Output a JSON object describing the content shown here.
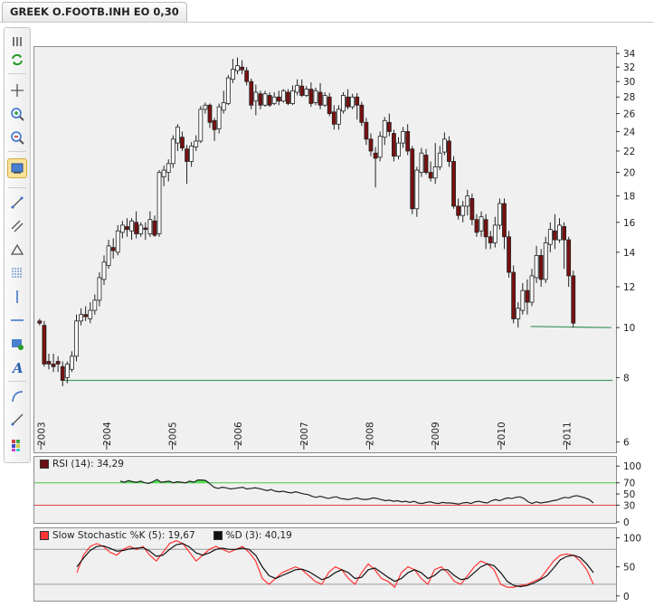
{
  "tab": {
    "label": "GREEK O.FOOTB.INH EO 0,30"
  },
  "toolbar": {
    "icons": [
      "grip-icon",
      "refresh-icon",
      "crosshair-icon",
      "zoom-in-icon",
      "zoom-out-icon",
      "chart-settings-icon",
      "trendline-icon",
      "channel-icon",
      "triangle-tool-icon",
      "fibonacci-icon",
      "vertical-line-icon",
      "horizontal-line-icon",
      "rectangle-tool-icon",
      "text-tool-icon",
      "arc-tool-icon",
      "ray-tool-icon",
      "palette-icon"
    ],
    "active": "chart-settings-icon"
  },
  "chart_data": [
    {
      "type": "candlestick",
      "y_scale": "log",
      "ylim": [
        5.8,
        35
      ],
      "y_ticks": [
        6,
        8,
        10,
        12,
        14,
        16,
        18,
        20,
        22,
        24,
        26,
        28,
        30,
        32,
        34
      ],
      "x_ticks": [
        "2003",
        "2004",
        "2005",
        "2006",
        "2007",
        "2008",
        "2009",
        "2010",
        "2011"
      ],
      "x_range": [
        2002.9,
        2011.75
      ],
      "colors": {
        "up": "#ffffff",
        "down": "#7a1010",
        "outline": "#222222",
        "trendline": "#4a9a6a"
      },
      "grid": false,
      "trendlines": [
        {
          "from": [
            2003.35,
            7.9
          ],
          "to": [
            2011.7,
            7.9
          ]
        },
        {
          "from": [
            2010.45,
            10.05
          ],
          "to": [
            2011.68,
            10.0
          ]
        }
      ],
      "candles": [
        [
          2002.98,
          10.3,
          10.2,
          10.4,
          10.1
        ],
        [
          2003.05,
          10.1,
          8.5,
          10.3,
          8.4
        ],
        [
          2003.12,
          8.6,
          8.5,
          8.9,
          8.3
        ],
        [
          2003.19,
          8.5,
          8.4,
          8.9,
          8.2
        ],
        [
          2003.26,
          8.6,
          8.5,
          8.8,
          8.2
        ],
        [
          2003.33,
          8.4,
          7.9,
          8.6,
          7.7
        ],
        [
          2003.4,
          8.0,
          8.5,
          8.6,
          7.8
        ],
        [
          2003.47,
          8.3,
          8.8,
          9.0,
          8.2
        ],
        [
          2003.54,
          8.8,
          10.3,
          10.6,
          8.6
        ],
        [
          2003.61,
          10.3,
          10.6,
          10.9,
          10.1
        ],
        [
          2003.68,
          10.6,
          10.5,
          11.0,
          10.3
        ],
        [
          2003.75,
          10.4,
          10.8,
          11.2,
          10.2
        ],
        [
          2003.82,
          10.8,
          11.3,
          11.6,
          10.6
        ],
        [
          2003.89,
          11.3,
          12.5,
          12.8,
          11.0
        ],
        [
          2003.96,
          12.4,
          13.4,
          13.8,
          12.1
        ],
        [
          2004.03,
          13.2,
          14.4,
          14.8,
          13.0
        ],
        [
          2004.1,
          14.3,
          14.1,
          14.9,
          13.6
        ],
        [
          2004.17,
          14.0,
          15.4,
          15.8,
          13.8
        ],
        [
          2004.24,
          15.3,
          15.8,
          16.1,
          14.9
        ],
        [
          2004.31,
          15.7,
          15.5,
          16.3,
          15.0
        ],
        [
          2004.38,
          15.4,
          16.1,
          16.3,
          14.8
        ],
        [
          2004.45,
          16.0,
          15.2,
          16.8,
          14.9
        ],
        [
          2004.52,
          15.2,
          15.8,
          16.0,
          15.0
        ],
        [
          2004.59,
          15.6,
          15.5,
          16.0,
          14.8
        ],
        [
          2004.66,
          15.2,
          16.2,
          16.8,
          15.0
        ],
        [
          2004.73,
          16.1,
          15.1,
          16.5,
          15.0
        ],
        [
          2004.8,
          15.2,
          20.0,
          20.2,
          15.0
        ],
        [
          2004.87,
          19.6,
          20.2,
          20.6,
          18.8
        ],
        [
          2004.94,
          20.0,
          20.8,
          21.2,
          19.2
        ],
        [
          2005.01,
          20.8,
          23.2,
          23.6,
          20.4
        ],
        [
          2005.08,
          22.8,
          24.5,
          24.8,
          22.0
        ],
        [
          2005.15,
          23.4,
          22.3,
          24.0,
          22.0
        ],
        [
          2005.22,
          22.2,
          21.0,
          22.6,
          19.0
        ],
        [
          2005.29,
          21.0,
          22.5,
          22.9,
          20.5
        ],
        [
          2005.36,
          22.4,
          23.0,
          23.6,
          22.0
        ],
        [
          2005.43,
          23.0,
          26.5,
          26.9,
          22.8
        ],
        [
          2005.5,
          26.5,
          27.0,
          27.3,
          26.0
        ],
        [
          2005.57,
          27.0,
          25.0,
          27.2,
          24.4
        ],
        [
          2005.64,
          25.2,
          24.2,
          25.5,
          23.0
        ],
        [
          2005.71,
          24.3,
          26.8,
          27.2,
          23.8
        ],
        [
          2005.78,
          26.4,
          27.3,
          28.8,
          26.0
        ],
        [
          2005.85,
          27.2,
          30.5,
          30.9,
          27.0
        ],
        [
          2005.92,
          30.3,
          31.7,
          33.2,
          29.8
        ],
        [
          2005.99,
          31.5,
          32.2,
          33.4,
          31.0
        ],
        [
          2006.06,
          32.0,
          31.6,
          33.0,
          31.0
        ],
        [
          2006.13,
          31.5,
          30.0,
          32.0,
          29.5
        ],
        [
          2006.2,
          30.0,
          27.0,
          30.4,
          26.5
        ],
        [
          2006.27,
          27.5,
          28.6,
          29.6,
          25.8
        ],
        [
          2006.34,
          28.4,
          27.0,
          28.8,
          26.5
        ],
        [
          2006.41,
          27.0,
          28.4,
          28.8,
          26.8
        ],
        [
          2006.48,
          28.2,
          27.0,
          28.6,
          26.8
        ],
        [
          2006.55,
          27.2,
          28.0,
          28.6,
          27.0
        ],
        [
          2006.62,
          28.0,
          27.5,
          28.8,
          27.0
        ],
        [
          2006.69,
          27.5,
          28.8,
          29.0,
          27.3
        ],
        [
          2006.76,
          28.6,
          27.2,
          29.0,
          27.0
        ],
        [
          2006.83,
          27.2,
          28.8,
          29.5,
          27.0
        ],
        [
          2006.9,
          28.6,
          29.5,
          30.3,
          28.2
        ],
        [
          2006.97,
          29.4,
          28.2,
          30.3,
          28.0
        ],
        [
          2007.04,
          28.2,
          29.0,
          29.4,
          28.0
        ],
        [
          2007.11,
          29.0,
          27.2,
          29.9,
          26.8
        ],
        [
          2007.18,
          27.3,
          28.8,
          29.2,
          27.0
        ],
        [
          2007.25,
          28.6,
          27.0,
          29.8,
          26.5
        ],
        [
          2007.32,
          27.0,
          28.2,
          28.6,
          26.8
        ],
        [
          2007.39,
          28.0,
          26.0,
          28.5,
          25.7
        ],
        [
          2007.46,
          26.2,
          24.8,
          27.0,
          24.2
        ],
        [
          2007.53,
          24.8,
          26.5,
          27.0,
          24.2
        ],
        [
          2007.6,
          26.3,
          28.2,
          28.6,
          26.0
        ],
        [
          2007.67,
          28.0,
          26.8,
          29.0,
          26.5
        ],
        [
          2007.74,
          26.8,
          28.0,
          28.4,
          26.5
        ],
        [
          2007.81,
          28.0,
          27.0,
          28.5,
          25.3
        ],
        [
          2007.88,
          27.0,
          25.0,
          27.4,
          24.6
        ],
        [
          2007.95,
          25.0,
          23.2,
          25.5,
          22.6
        ],
        [
          2008.02,
          23.2,
          22.0,
          23.8,
          21.5
        ],
        [
          2008.09,
          21.8,
          21.3,
          22.4,
          18.7
        ],
        [
          2008.16,
          21.4,
          23.5,
          24.0,
          21.0
        ],
        [
          2008.23,
          23.4,
          25.2,
          25.6,
          22.6
        ],
        [
          2008.3,
          25.0,
          24.0,
          26.0,
          23.5
        ],
        [
          2008.37,
          23.8,
          21.5,
          24.2,
          21.0
        ],
        [
          2008.44,
          21.5,
          22.8,
          23.4,
          21.2
        ],
        [
          2008.51,
          22.8,
          24.0,
          24.5,
          22.3
        ],
        [
          2008.58,
          24.0,
          22.0,
          24.8,
          21.6
        ],
        [
          2008.65,
          22.2,
          17.0,
          22.5,
          16.6
        ],
        [
          2008.72,
          17.0,
          20.2,
          20.5,
          16.4
        ],
        [
          2008.79,
          20.0,
          21.8,
          22.3,
          19.6
        ],
        [
          2008.86,
          21.6,
          20.0,
          22.2,
          19.8
        ],
        [
          2008.93,
          20.0,
          19.5,
          21.0,
          19.2
        ],
        [
          2009.0,
          19.5,
          20.5,
          22.8,
          19.0
        ],
        [
          2009.07,
          20.5,
          21.8,
          22.5,
          20.2
        ],
        [
          2009.14,
          21.9,
          23.2,
          23.9,
          21.6
        ],
        [
          2009.21,
          23.0,
          21.0,
          23.5,
          20.5
        ],
        [
          2009.28,
          21.0,
          17.2,
          21.5,
          17.0
        ],
        [
          2009.35,
          17.2,
          16.5,
          17.8,
          16.2
        ],
        [
          2009.42,
          16.5,
          17.2,
          17.6,
          16.0
        ],
        [
          2009.49,
          17.2,
          18.0,
          18.5,
          16.5
        ],
        [
          2009.56,
          17.8,
          16.2,
          18.2,
          15.8
        ],
        [
          2009.63,
          16.2,
          15.3,
          16.6,
          15.0
        ],
        [
          2009.7,
          15.4,
          16.4,
          16.8,
          15.0
        ],
        [
          2009.77,
          16.2,
          15.0,
          16.6,
          14.2
        ],
        [
          2009.84,
          15.0,
          14.6,
          15.4,
          14.2
        ],
        [
          2009.91,
          14.6,
          15.8,
          16.4,
          14.3
        ],
        [
          2009.98,
          15.8,
          17.4,
          17.8,
          15.5
        ],
        [
          2010.05,
          17.4,
          15.0,
          17.8,
          14.2
        ],
        [
          2010.12,
          15.0,
          12.8,
          15.4,
          12.5
        ],
        [
          2010.19,
          12.8,
          10.4,
          13.2,
          10.2
        ],
        [
          2010.26,
          10.4,
          10.9,
          11.2,
          10.0
        ],
        [
          2010.33,
          10.8,
          11.8,
          12.2,
          10.6
        ],
        [
          2010.4,
          11.8,
          11.2,
          12.4,
          10.6
        ],
        [
          2010.47,
          11.2,
          12.6,
          13.0,
          11.0
        ],
        [
          2010.54,
          12.5,
          13.8,
          14.4,
          12.2
        ],
        [
          2010.61,
          13.8,
          12.4,
          14.2,
          12.0
        ],
        [
          2010.68,
          12.4,
          14.6,
          15.0,
          12.2
        ],
        [
          2010.75,
          14.5,
          15.5,
          16.0,
          14.0
        ],
        [
          2010.82,
          15.4,
          14.8,
          16.6,
          14.2
        ],
        [
          2010.89,
          14.8,
          15.8,
          16.3,
          14.6
        ],
        [
          2010.96,
          15.7,
          14.8,
          16.0,
          13.0
        ],
        [
          2011.03,
          14.8,
          12.6,
          15.0,
          12.0
        ],
        [
          2011.1,
          12.6,
          10.2,
          12.9,
          10.0
        ]
      ]
    },
    {
      "type": "line",
      "title": "RSI (14): 34,29",
      "ylim": [
        0,
        110
      ],
      "y_ticks": [
        100,
        70,
        50,
        30,
        0
      ],
      "reference_lines": [
        {
          "value": 70,
          "color": "#44cc44"
        },
        {
          "value": 30,
          "color": "#dd4444"
        }
      ],
      "fill_above_70": "#55e055",
      "series": [
        {
          "color": "#222222",
          "values": [
            73,
            71,
            74,
            72,
            71,
            73,
            70,
            69,
            72,
            76,
            71,
            72,
            73,
            70,
            72,
            71,
            70,
            73,
            71,
            75,
            75,
            74,
            68,
            62,
            60,
            62,
            61,
            59,
            60,
            61,
            62,
            59,
            60,
            61,
            60,
            58,
            56,
            58,
            55,
            54,
            55,
            53,
            52,
            54,
            52,
            50,
            49,
            46,
            44,
            46,
            44,
            42,
            44,
            45,
            42,
            41,
            40,
            42,
            43,
            41,
            40,
            41,
            43,
            42,
            40,
            38,
            39,
            37,
            38,
            36,
            37,
            35,
            37,
            34,
            33,
            35,
            36,
            34,
            33,
            35,
            34,
            34,
            33,
            32,
            34,
            35,
            33,
            36,
            37,
            35,
            34,
            38,
            40,
            38,
            41,
            43,
            42,
            44,
            45,
            42,
            36,
            33,
            36,
            34,
            35,
            36,
            38,
            39,
            42,
            44,
            43,
            46,
            47,
            45,
            43,
            40,
            34
          ]
        }
      ]
    },
    {
      "type": "line",
      "title_k": "Slow Stochastic %K (5): 19,67",
      "title_d": "%D (3): 40,19",
      "ylim": [
        -5,
        110
      ],
      "y_ticks": [
        100,
        50,
        0
      ],
      "reference_lines": [
        {
          "value": 80,
          "color": "#9a9a9a"
        },
        {
          "value": 20,
          "color": "#9a9a9a"
        }
      ],
      "series": [
        {
          "name": "%K",
          "color": "#ff3333",
          "values": [
            40,
            70,
            85,
            90,
            85,
            75,
            70,
            80,
            85,
            80,
            85,
            70,
            60,
            75,
            90,
            95,
            90,
            75,
            60,
            70,
            80,
            85,
            80,
            75,
            80,
            85,
            75,
            60,
            30,
            20,
            30,
            40,
            45,
            50,
            45,
            35,
            25,
            20,
            40,
            50,
            45,
            30,
            20,
            40,
            55,
            45,
            30,
            25,
            15,
            40,
            50,
            45,
            30,
            20,
            45,
            50,
            40,
            25,
            20,
            35,
            50,
            60,
            55,
            45,
            20,
            15,
            15,
            18,
            20,
            25,
            30,
            45,
            60,
            70,
            72,
            70,
            60,
            45,
            20
          ]
        },
        {
          "name": "%D",
          "color": "#111111",
          "values": [
            50,
            65,
            78,
            85,
            86,
            82,
            77,
            78,
            81,
            82,
            83,
            77,
            68,
            70,
            80,
            88,
            90,
            84,
            74,
            70,
            74,
            80,
            82,
            80,
            80,
            82,
            80,
            70,
            50,
            35,
            30,
            35,
            40,
            45,
            46,
            42,
            35,
            28,
            32,
            40,
            45,
            40,
            30,
            32,
            45,
            48,
            40,
            32,
            25,
            30,
            40,
            45,
            40,
            30,
            35,
            45,
            45,
            35,
            28,
            30,
            40,
            50,
            55,
            52,
            40,
            25,
            18,
            16,
            18,
            22,
            28,
            35,
            48,
            62,
            68,
            70,
            66,
            55,
            40
          ]
        }
      ]
    }
  ]
}
